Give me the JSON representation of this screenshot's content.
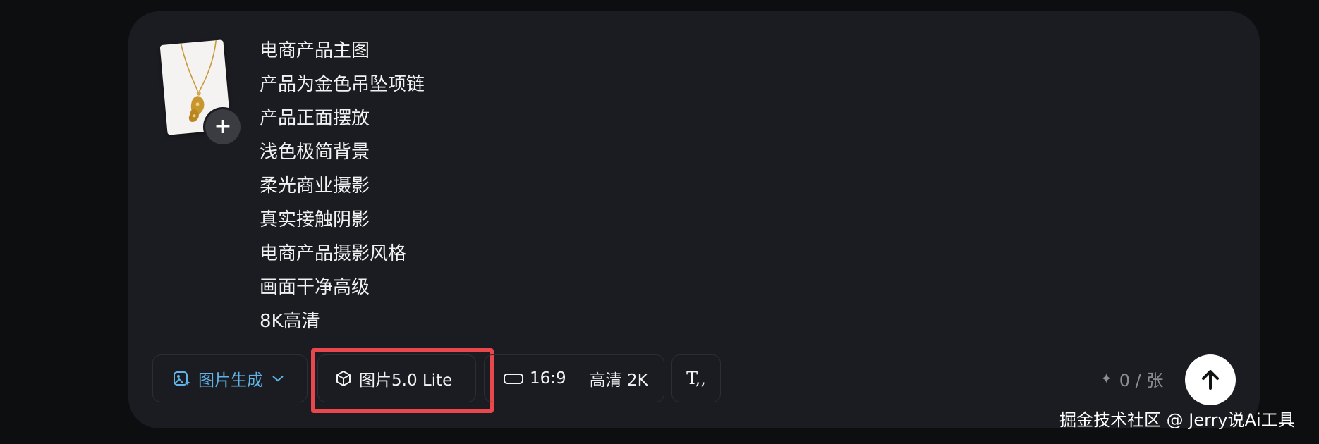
{
  "prompt": {
    "lines": [
      "电商产品主图",
      "产品为金色吊坠项链",
      "产品正面摆放",
      "浅色极简背景",
      "柔光商业摄影",
      "真实接触阴影",
      "电商产品摄影风格",
      "画面干净高级",
      "8K高清"
    ]
  },
  "attachment": {
    "add_label": "+"
  },
  "toolbar": {
    "mode_label": "图片生成",
    "model_label": "图片5.0 Lite",
    "ratio_label": "16:9",
    "quality_label": "高清 2K",
    "text_icon_label": "T,,"
  },
  "credits": {
    "label": "0 / 张"
  },
  "watermark": {
    "text": "掘金技术社区 @ Jerry说Ai工具"
  },
  "icons": {
    "mode": "image-sparkle-icon",
    "mode_chevron": "chevron-down-icon",
    "model": "cube-icon",
    "ratio": "aspect-ratio-icon",
    "text": "text-style-icon",
    "credits": "sparkle-icon",
    "send": "arrow-up-icon"
  },
  "colors": {
    "background": "#0d0e10",
    "panel": "#1b1c21",
    "accent": "#5fb3e6",
    "highlight": "#e8474c",
    "muted": "#8b8d93"
  }
}
